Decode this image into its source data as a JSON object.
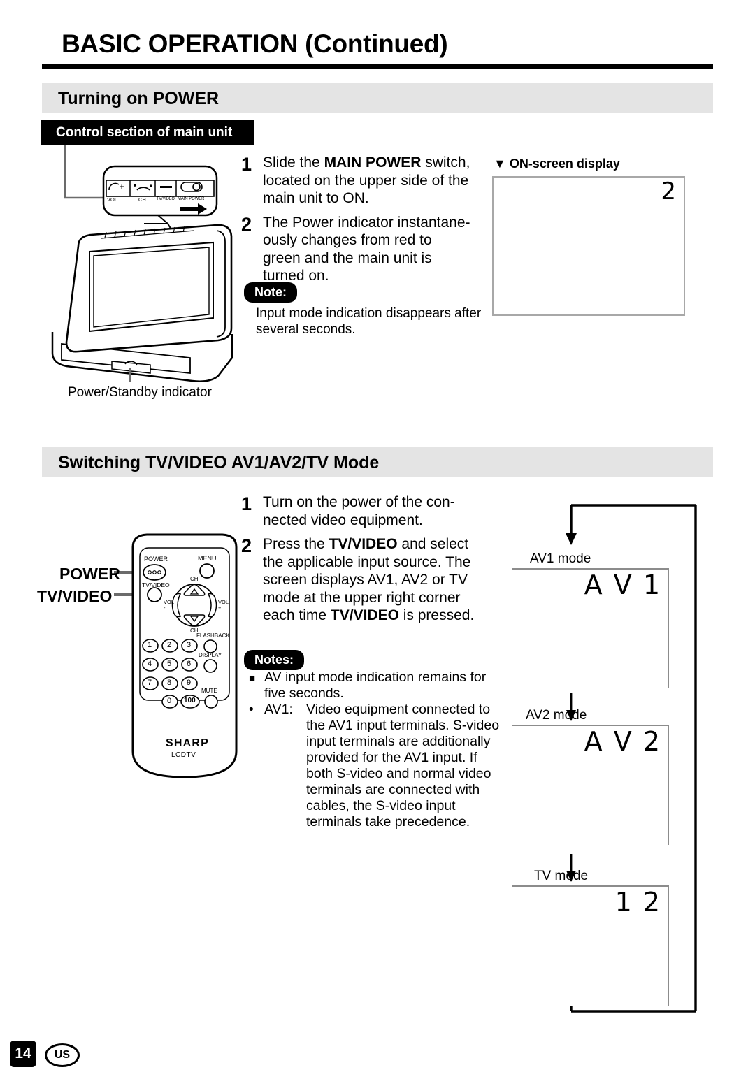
{
  "header": {
    "title": "BASIC OPERATION (Continued)"
  },
  "sections": {
    "power": {
      "band_title": "Turning on POWER",
      "tag_label": "Control section of main unit",
      "steps": [
        {
          "num": "1",
          "text_before": "Slide the ",
          "bold": "MAIN POWER",
          "text_after": " switch, located on the upper side of the main unit to ON."
        },
        {
          "num": "2",
          "text_before": "The Power indicator instantane-ously changes from red to green and the main unit is turned on.",
          "bold": "",
          "text_after": ""
        }
      ],
      "note_pill": "Note:",
      "note_text": "Input mode indication disappears after several seconds.",
      "indicator_label": "Power/Standby indicator",
      "control_panel": {
        "vol_label": "VOL",
        "vol_plus": "+",
        "ch_label": "CH",
        "ch_down": "▼",
        "ch_up": "▲",
        "tvvideo_label": "TV/VIDEO",
        "mainpower_label": "MAIN POWER"
      },
      "osd": {
        "caption": "▼ ON-screen display",
        "value": "2"
      }
    },
    "switching": {
      "band_title": "Switching TV/VIDEO AV1/AV2/TV Mode",
      "steps": [
        {
          "num": "1",
          "text_before": "Turn on the power of the con-nected video equipment.",
          "bold": "",
          "text_after": ""
        },
        {
          "num": "2",
          "text_before": "Press the ",
          "bold": "TV/VIDEO",
          "text_mid": " and select the applicable input source. The screen displays AV1, AV2 or TV mode at the upper right corner each time ",
          "bold2": "TV/VIDEO",
          "text_after": " is pressed."
        }
      ],
      "notes_pill": "Notes:",
      "notes": [
        {
          "bullet": "square",
          "text": "AV input mode indication remains for five seconds."
        },
        {
          "bullet": "dot",
          "label": "AV1:",
          "text": "Video equipment connected to the AV1 input terminals. S-video input terminals are additionally provided for the AV1 input. If both S-video and normal video terminals are connected with cables, the S-video input terminals take precedence."
        }
      ],
      "remote": {
        "callout_power": "POWER",
        "callout_tvvideo": "TV/VIDEO",
        "btn_power": "POWER",
        "btn_menu": "MENU",
        "btn_tvvideo": "TV/VIDEO",
        "label_ch_top": "CH",
        "label_ch_bottom": "CH",
        "label_vol_minus": "VOL",
        "label_vol_minus_sign": "-",
        "label_vol_plus": "VOL",
        "label_vol_plus_sign": "+",
        "btn_flashback": "FLASHBACK",
        "btn_display": "DISPLAY",
        "btn_mute": "MUTE",
        "numbers": [
          "1",
          "2",
          "3",
          "4",
          "5",
          "6",
          "7",
          "8",
          "9",
          "0",
          "100"
        ],
        "brand": "SHARP",
        "model": "LCDTV"
      },
      "flow": [
        {
          "label": "AV1 mode",
          "screen_value": "A V 1"
        },
        {
          "label": "AV2 mode",
          "screen_value": "A V 2"
        },
        {
          "label": "TV mode",
          "screen_value": "1 2"
        }
      ]
    }
  },
  "footer": {
    "page_number": "14",
    "region": "US"
  },
  "colors": {
    "band_gray": "#e4e4e4",
    "tag_black": "#000000",
    "screen_border": "#8c8c8c"
  }
}
